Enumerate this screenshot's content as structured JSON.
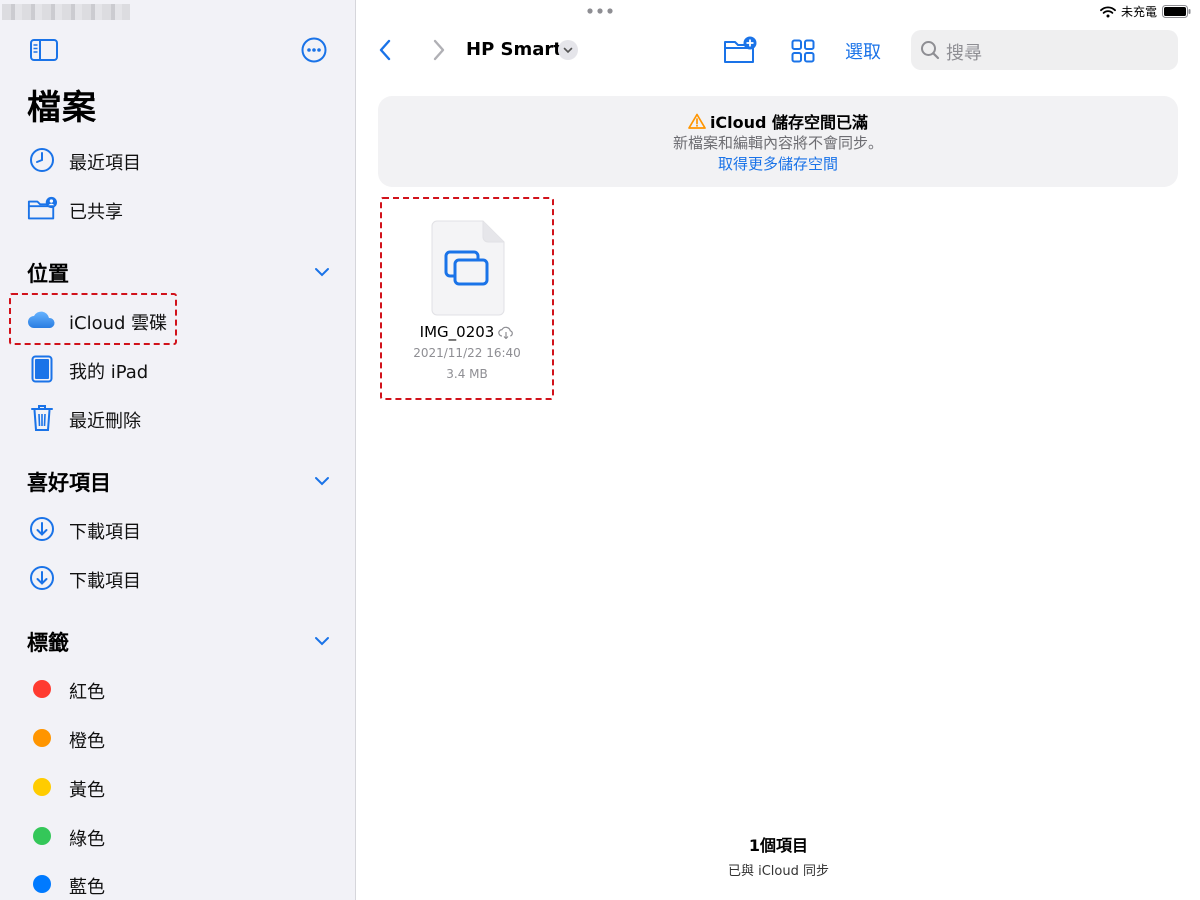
{
  "app": {
    "sidebar_title": "檔案"
  },
  "sidebar": {
    "top_items": [
      {
        "label": "最近項目",
        "icon": "clock-icon"
      },
      {
        "label": "已共享",
        "icon": "shared-folder-icon"
      }
    ],
    "locations": {
      "title": "位置",
      "items": [
        {
          "label": "iCloud 雲碟",
          "icon": "icloud-icon"
        },
        {
          "label": "我的 iPad",
          "icon": "ipad-icon"
        },
        {
          "label": "最近刪除",
          "icon": "trash-icon"
        }
      ]
    },
    "favorites": {
      "title": "喜好項目",
      "items": [
        {
          "label": "下載項目",
          "icon": "download-icon"
        },
        {
          "label": "下載項目",
          "icon": "download-icon"
        }
      ]
    },
    "tags": {
      "title": "標籤",
      "items": [
        {
          "label": "紅色",
          "color": "#ff3b30"
        },
        {
          "label": "橙色",
          "color": "#ff9500"
        },
        {
          "label": "黃色",
          "color": "#ffcc00"
        },
        {
          "label": "綠色",
          "color": "#34c759"
        },
        {
          "label": "藍色",
          "color": "#007aff"
        }
      ]
    }
  },
  "status_bar": {
    "charging_text": "未充電"
  },
  "toolbar": {
    "folder_title": "HP Smart",
    "select_label": "選取",
    "search_placeholder": "搜尋"
  },
  "banner": {
    "title": "iCloud 儲存空間已滿",
    "subtitle": "新檔案和編輯內容將不會同步。",
    "link": "取得更多儲存空間"
  },
  "files": [
    {
      "name": "IMG_0203",
      "date": "2021/11/22 16:40",
      "size": "3.4 MB"
    }
  ],
  "footer": {
    "count": "1個項目",
    "sync_status": "已與 iCloud 同步"
  },
  "colors": {
    "accent": "#1a73e8",
    "highlight": "#d1121b",
    "warning": "#ff9500"
  }
}
